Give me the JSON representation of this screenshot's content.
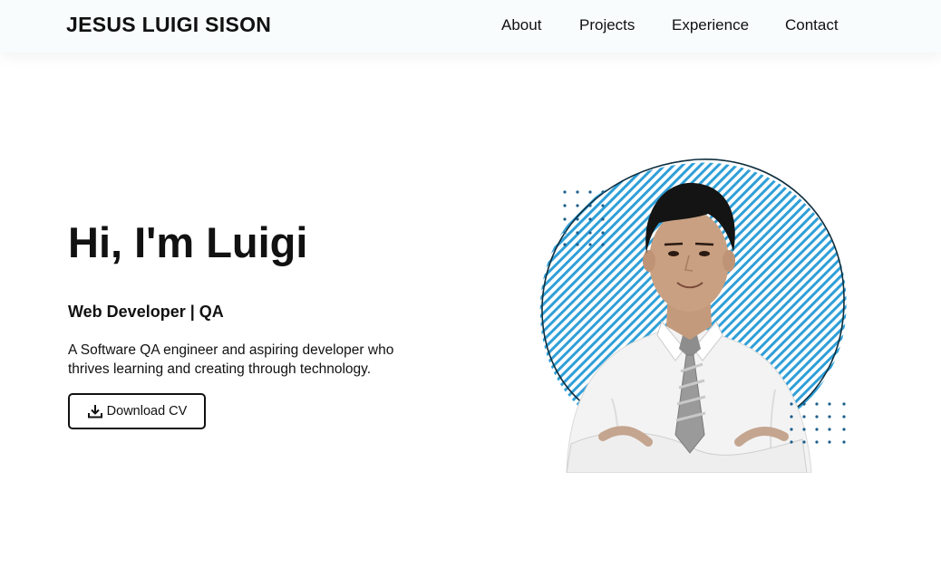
{
  "nav": {
    "brand": "JESUS LUIGI SISON",
    "links": [
      "About",
      "Projects",
      "Experience",
      "Contact"
    ]
  },
  "hero": {
    "title": "Hi, I'm Luigi",
    "role": "Web Developer | QA",
    "description": "A Software QA engineer and aspiring developer who thrives learning and creating through technology.",
    "cv_button_label": "Download CV",
    "cv_button_icon": "download-icon"
  },
  "colors": {
    "accent_blue": "#2f9fd8",
    "dot_blue": "#1c5e8c",
    "text": "#111111",
    "nav_bg": "#f8fcfc"
  }
}
